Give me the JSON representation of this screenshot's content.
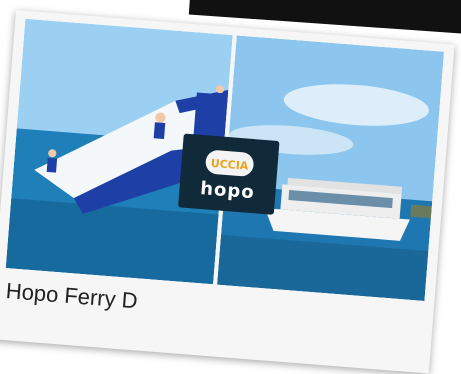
{
  "card": {
    "title": "Hopo Ferry D",
    "logo_wordmark": "hopo",
    "logo_lettering": "UCCIA"
  },
  "photos": [
    {
      "name": "inflatable-water-slide-photo"
    },
    {
      "name": "hopo-ferry-boat-photo"
    }
  ],
  "colors": {
    "sea": "#1f7fb8",
    "sky": "#9bcdf2",
    "logo_bg": "#102a3a"
  }
}
